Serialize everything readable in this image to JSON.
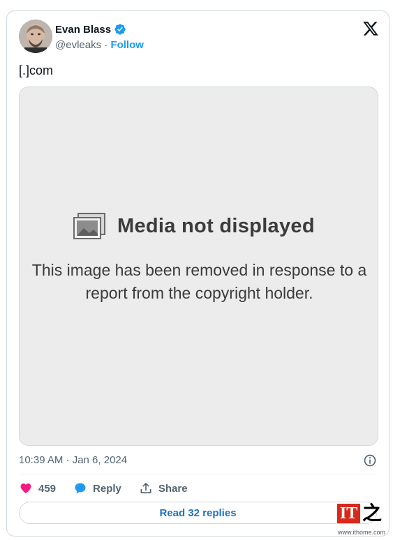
{
  "author": {
    "name": "Evan Blass",
    "handle": "@evleaks",
    "separator": "·",
    "follow_label": "Follow",
    "verified_color": "#1d9bf0"
  },
  "tweet": {
    "text": "[.]com",
    "timestamp": "10:39 AM · Jan 6, 2024"
  },
  "media": {
    "title": "Media not displayed",
    "message_line1": "This image has been removed in response to a",
    "message_line2": "report from the copyright holder."
  },
  "actions": {
    "likes_count": "459",
    "reply_label": "Reply",
    "share_label": "Share"
  },
  "read_replies_label": "Read 32 replies",
  "watermark": {
    "logo_text": "IT",
    "logo_char": "之",
    "url": "www.ithome.com"
  },
  "colors": {
    "accent": "#1d9bf0",
    "heart": "#f91880",
    "muted": "#536471",
    "border": "#cfd9de",
    "media_bg": "#ececec"
  },
  "icons": [
    "verified-badge-icon",
    "x-logo-icon",
    "broken-image-icon",
    "info-icon",
    "heart-icon",
    "reply-bubble-icon",
    "share-icon"
  ]
}
